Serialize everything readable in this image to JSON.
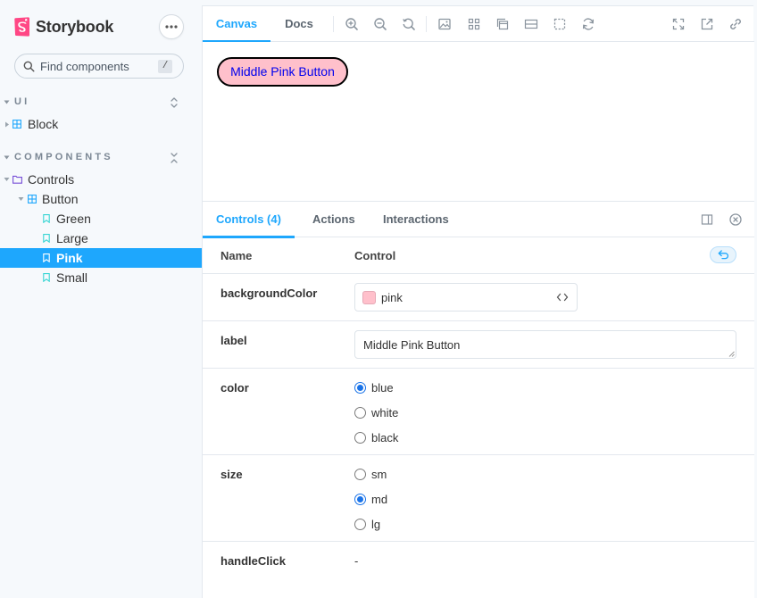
{
  "colors": {
    "accent": "#1ea7fd",
    "brand": "#ff4785",
    "pink_swatch": "#ffc0cb",
    "button_text": "#0000ee"
  },
  "sidebar": {
    "brand_name": "Storybook",
    "search": {
      "placeholder": "Find components",
      "shortcut": "/"
    },
    "sections": [
      {
        "title": "UI",
        "items": [
          {
            "label": "Block",
            "icon": "component-icon"
          }
        ]
      },
      {
        "title": "COMPONENTS"
      }
    ],
    "tree": {
      "folder": "Controls",
      "component": "Button",
      "stories": [
        "Green",
        "Large",
        "Pink",
        "Small"
      ],
      "selected": "Pink"
    }
  },
  "toolbar": {
    "tabs": [
      "Canvas",
      "Docs"
    ],
    "active_tab": "Canvas"
  },
  "canvas": {
    "button_label": "Middle Pink Button"
  },
  "addons": {
    "tabs": [
      "Controls (4)",
      "Actions",
      "Interactions"
    ],
    "active_tab": "Controls (4)",
    "columns": [
      "Name",
      "Control"
    ],
    "rows": {
      "background_color": {
        "name": "backgroundColor",
        "value": "pink"
      },
      "label": {
        "name": "label",
        "value": "Middle Pink Button"
      },
      "color": {
        "name": "color",
        "options": [
          "blue",
          "white",
          "black"
        ],
        "selected": "blue"
      },
      "size": {
        "name": "size",
        "options": [
          "sm",
          "md",
          "lg"
        ],
        "selected": "md"
      },
      "handle_click": {
        "name": "handleClick",
        "value": "-"
      }
    }
  }
}
